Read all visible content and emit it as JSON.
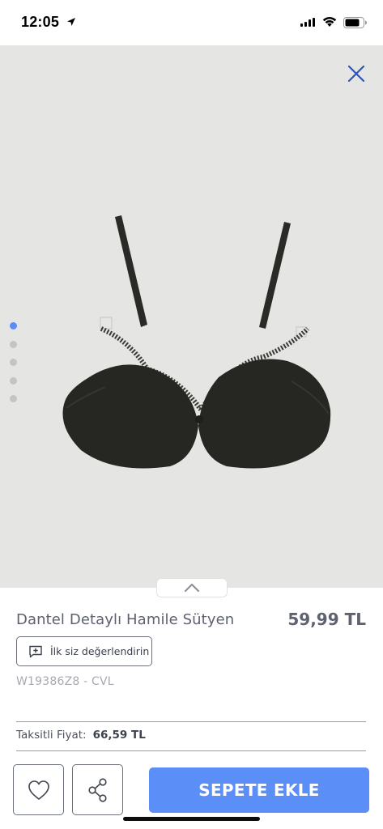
{
  "status_bar": {
    "time": "12:05",
    "battery_icon": "battery-icon",
    "wifi_icon": "wifi-icon",
    "signal_icon": "signal-icon"
  },
  "gallery": {
    "image_count": 5,
    "active_index": 0,
    "close_icon": "close-icon",
    "accent": "#5b8df5",
    "background": "#e5e5e3"
  },
  "product": {
    "title": "Dantel Detaylı Hamile Sütyen",
    "price": "59,99 TL",
    "review_label": "İlk siz değerlendirin",
    "sku": "W19386Z8 - CVL",
    "installment_label": "Taksitli Fiyat:",
    "installment_price": "66,59 TL"
  },
  "actions": {
    "cart_label": "SEPETE EKLE",
    "cart_color": "#5b8ef6",
    "favorite_icon": "heart-icon",
    "share_icon": "share-icon"
  }
}
